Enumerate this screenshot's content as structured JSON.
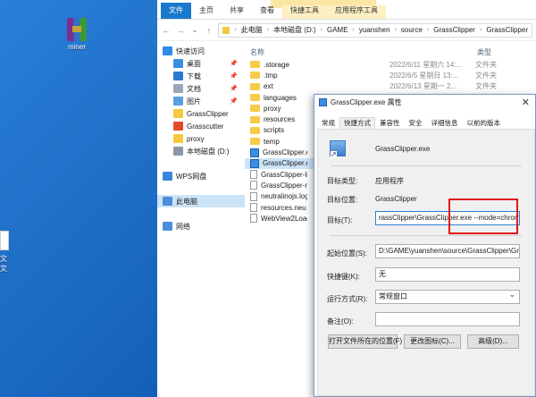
{
  "desktop": {
    "icon_label": "miner",
    "clipped_text": [
      "文",
      "文"
    ]
  },
  "ribbon": {
    "tabs": [
      "文件",
      "主页",
      "共享",
      "查看",
      "快捷工具",
      "应用程序工具"
    ]
  },
  "address": {
    "crumbs": [
      "此电脑",
      "本地磁盘 (D:)",
      "GAME",
      "yuanshen",
      "source",
      "GrassClipper",
      "GrassClipper"
    ]
  },
  "nav": {
    "items": [
      {
        "label": "快速访问",
        "icon": "star-icon",
        "color": "#2f8ae8",
        "indent": 0,
        "pinned": false,
        "selected": false
      },
      {
        "label": "桌面",
        "icon": "desktop-icon",
        "color": "#3b8fe0",
        "indent": 1,
        "pinned": true,
        "selected": false
      },
      {
        "label": "下载",
        "icon": "download-icon",
        "color": "#2a7ad4",
        "indent": 1,
        "pinned": true,
        "selected": false
      },
      {
        "label": "文档",
        "icon": "document-icon",
        "color": "#9aa7b8",
        "indent": 1,
        "pinned": true,
        "selected": false
      },
      {
        "label": "图片",
        "icon": "pictures-icon",
        "color": "#5a9fe0",
        "indent": 1,
        "pinned": true,
        "selected": false
      },
      {
        "label": "GrassClipper",
        "icon": "folder-icon",
        "color": "#f5c93f",
        "indent": 1,
        "pinned": false,
        "selected": false
      },
      {
        "label": "Grasscutter",
        "icon": "app-icon",
        "color": "#e24a2b",
        "indent": 1,
        "pinned": false,
        "selected": false
      },
      {
        "label": "proxy",
        "icon": "folder-icon",
        "color": "#f5c93f",
        "indent": 1,
        "pinned": false,
        "selected": false
      },
      {
        "label": "本地磁盘 (D:)",
        "icon": "drive-icon",
        "color": "#8c97a5",
        "indent": 1,
        "pinned": false,
        "selected": false
      },
      {
        "label": "",
        "icon": "",
        "color": "",
        "indent": 0,
        "pinned": false,
        "selected": false
      },
      {
        "label": "WPS网盘",
        "icon": "cloud-icon",
        "color": "#3a86d8",
        "indent": 0,
        "pinned": false,
        "selected": false
      },
      {
        "label": "",
        "icon": "",
        "color": "",
        "indent": 0,
        "pinned": false,
        "selected": false
      },
      {
        "label": "此电脑",
        "icon": "computer-icon",
        "color": "#4a8fd8",
        "indent": 0,
        "pinned": false,
        "selected": true
      },
      {
        "label": "",
        "icon": "",
        "color": "",
        "indent": 0,
        "pinned": false,
        "selected": false
      },
      {
        "label": "网络",
        "icon": "network-icon",
        "color": "#4a8fd8",
        "indent": 0,
        "pinned": false,
        "selected": false
      }
    ]
  },
  "files": {
    "col_name": "名称",
    "col_date": "修改日期",
    "col_type": "类型",
    "rows": [
      {
        "name": ".storage",
        "kind": "folder",
        "date": "2022/6/11 星期六 14:...",
        "type": "文件夹",
        "selected": false
      },
      {
        "name": ".tmp",
        "kind": "folder",
        "date": "2022/6/5 星期日 13:...",
        "type": "文件夹",
        "selected": false
      },
      {
        "name": "ext",
        "kind": "folder",
        "date": "2022/6/13 星期一 2...",
        "type": "文件夹",
        "selected": false
      },
      {
        "name": "languages",
        "kind": "folder",
        "date": "",
        "type": "",
        "selected": false
      },
      {
        "name": "proxy",
        "kind": "folder",
        "date": "",
        "type": "",
        "selected": false
      },
      {
        "name": "resources",
        "kind": "folder",
        "date": "",
        "type": "",
        "selected": false
      },
      {
        "name": "scripts",
        "kind": "folder",
        "date": "",
        "type": "",
        "selected": false
      },
      {
        "name": "temp",
        "kind": "folder",
        "date": "",
        "type": "",
        "selected": false
      },
      {
        "name": "GrassClipper.exe",
        "kind": "exe",
        "date": "",
        "type": "",
        "selected": false
      },
      {
        "name": "GrassClipper.exe",
        "kind": "shortcut",
        "date": "",
        "type": "",
        "selected": true
      },
      {
        "name": "GrassClipper-linu",
        "kind": "text",
        "date": "",
        "type": "",
        "selected": false
      },
      {
        "name": "GrassClipper-ma",
        "kind": "text",
        "date": "",
        "type": "",
        "selected": false
      },
      {
        "name": "neutralinojs.log",
        "kind": "text",
        "date": "",
        "type": "",
        "selected": false
      },
      {
        "name": "resources.neu",
        "kind": "text",
        "date": "",
        "type": "",
        "selected": false
      },
      {
        "name": "WebView2Loade",
        "kind": "text",
        "date": "",
        "type": "",
        "selected": false
      }
    ]
  },
  "dialog": {
    "title": "GrassClipper.exe 属性",
    "close": "✕",
    "tabs": [
      "常规",
      "快捷方式",
      "兼容性",
      "安全",
      "详细信息",
      "以前的版本"
    ],
    "active_tab": "快捷方式",
    "filename": "GrassClipper.exe",
    "target_type_label": "目标类型:",
    "target_type_value": "应用程序",
    "target_location_label": "目标位置:",
    "target_location_value": "GrassClipper",
    "target_label": "目标(T):",
    "target_value": "rassClipper\\GrassClipper.exe --mode=chrome",
    "start_in_label": "起始位置(S):",
    "start_in_value": "D:\\GAME\\yuanshen\\source\\GrassClipper\\Grass",
    "hotkey_label": "快捷键(K):",
    "hotkey_value": "无",
    "run_label": "运行方式(R):",
    "run_value": "常规窗口",
    "comment_label": "备注(O):",
    "comment_value": "",
    "btn_open_location": "打开文件所在的位置(F)",
    "btn_change_icon": "更改图标(C)...",
    "btn_advanced": "高级(D)..."
  },
  "colors": {
    "accent": "#1979ca",
    "highlight_box": "#e0151a",
    "selection": "#cce4f7"
  }
}
